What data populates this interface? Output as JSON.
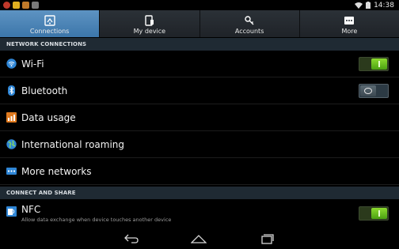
{
  "status_bar": {
    "time": "14:38",
    "left_icons": [
      "alert-icon",
      "puzzle-icon",
      "image-icon",
      "mail-icon"
    ],
    "right_icons": [
      "wifi-icon",
      "battery-icon"
    ]
  },
  "tabs": [
    {
      "label": "Connections",
      "icon": "connections-icon",
      "active": true
    },
    {
      "label": "My device",
      "icon": "device-icon",
      "active": false
    },
    {
      "label": "Accounts",
      "icon": "key-icon",
      "active": false
    },
    {
      "label": "More",
      "icon": "more-icon",
      "active": false
    }
  ],
  "sections": [
    {
      "header": "NETWORK CONNECTIONS",
      "items": [
        {
          "label": "Wi-Fi",
          "icon": "wifi-icon",
          "toggle": "on"
        },
        {
          "label": "Bluetooth",
          "icon": "bluetooth-icon",
          "toggle": "off"
        },
        {
          "label": "Data usage",
          "icon": "data-usage-icon"
        },
        {
          "label": "International roaming",
          "icon": "globe-icon"
        },
        {
          "label": "More networks",
          "icon": "more-networks-icon"
        }
      ]
    },
    {
      "header": "CONNECT AND SHARE",
      "items": [
        {
          "label": "NFC",
          "sublabel": "Allow data exchange when device touches another device",
          "icon": "nfc-icon",
          "toggle": "on"
        }
      ]
    }
  ],
  "nav": [
    "back-icon",
    "home-icon",
    "recent-apps-icon"
  ],
  "colors": {
    "active_tab": "#4a86bb",
    "toggle_on": "#6cc81f",
    "section_bg": "#1f2a33"
  }
}
